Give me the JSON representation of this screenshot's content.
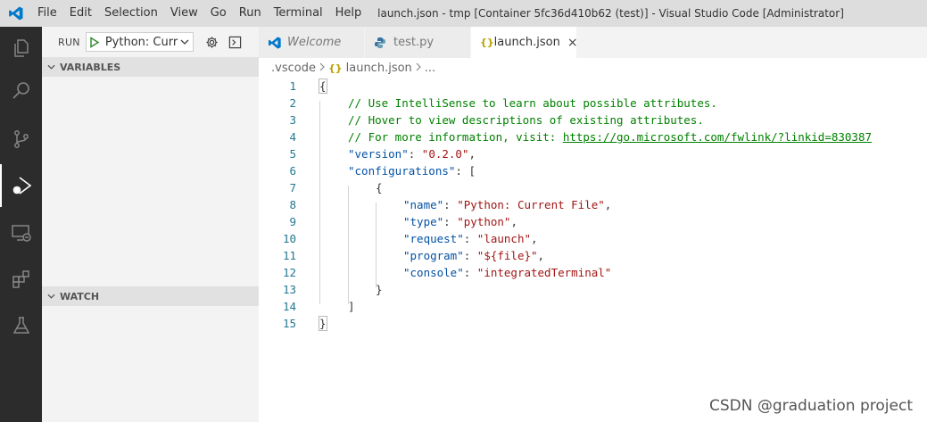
{
  "menu": [
    "File",
    "Edit",
    "Selection",
    "View",
    "Go",
    "Run",
    "Terminal",
    "Help"
  ],
  "window_title": "launch.json - tmp [Container 5fc36d410b62 (test)] - Visual Studio Code [Administrator]",
  "run_toolbar": {
    "label": "RUN",
    "config": "Python: Curr"
  },
  "sections": {
    "variables": "VARIABLES",
    "watch": "WATCH"
  },
  "tabs": [
    {
      "label": "Welcome"
    },
    {
      "label": "test.py"
    },
    {
      "label": "launch.json",
      "close": "×"
    }
  ],
  "breadcrumb": {
    "folder": ".vscode",
    "file_icon": "{}",
    "file": "launch.json",
    "more": "..."
  },
  "code": {
    "l1": "{",
    "l2": "// Use IntelliSense to learn about possible attributes.",
    "l3": "// Hover to view descriptions of existing attributes.",
    "l4": "// For more information, visit: ",
    "l4_url": "https://go.microsoft.com/fwlink/?linkid=830387",
    "l5_key": "\"version\"",
    "l5_val": "\"0.2.0\"",
    "l6_key": "\"configurations\"",
    "l6_rest": ": [",
    "l7": "{",
    "l8_key": "\"name\"",
    "l8_val": "\"Python: Current File\"",
    "l9_key": "\"type\"",
    "l9_val": "\"python\"",
    "l10_key": "\"request\"",
    "l10_val": "\"launch\"",
    "l11_key": "\"program\"",
    "l11_val": "\"${file}\"",
    "l12_key": "\"console\"",
    "l12_val": "\"integratedTerminal\"",
    "l13": "}",
    "l14": "]",
    "l15": "}"
  },
  "line_numbers": [
    "1",
    "2",
    "3",
    "4",
    "5",
    "6",
    "7",
    "8",
    "9",
    "10",
    "11",
    "12",
    "13",
    "14",
    "15"
  ],
  "watermark": "CSDN @graduation project",
  "colors": {
    "activity_bar": "#2c2c2c",
    "sidebar": "#f3f3f3",
    "titlebar": "#dddddd",
    "accent": "#007acc",
    "comment": "#008000",
    "key": "#0451a5",
    "string": "#a31515"
  }
}
